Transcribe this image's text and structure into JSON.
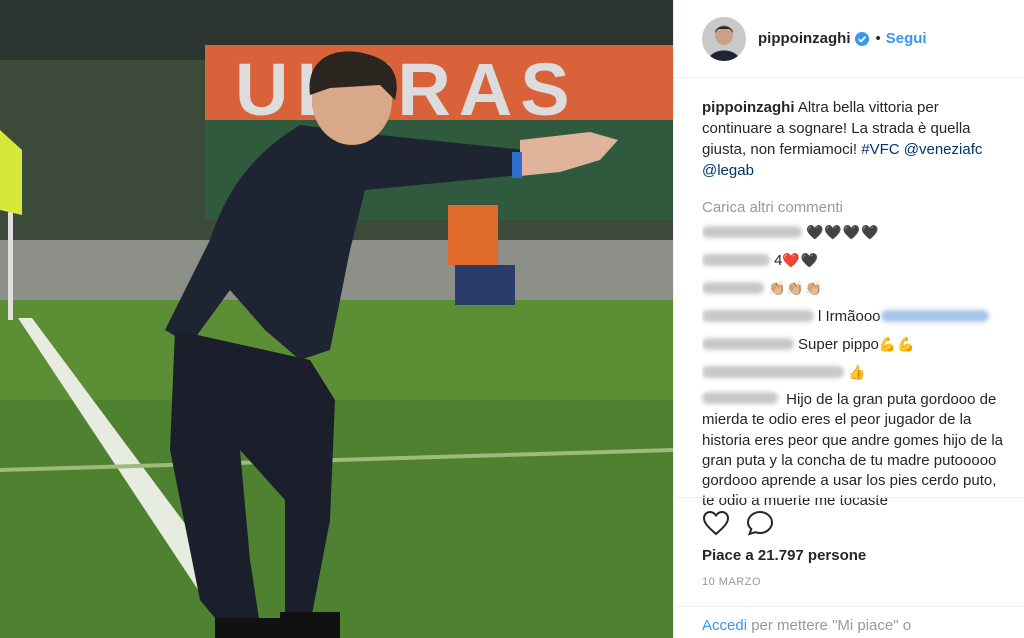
{
  "post": {
    "username": "pippoinzaghi",
    "verified": true,
    "separator": "•",
    "follow_label": "Segui"
  },
  "photo": {
    "banner_text": "ULTRAS"
  },
  "caption": {
    "username": "pippoinzaghi",
    "text": " Altra bella vittoria per continuare a sognare! La strada è quella giusta, non fermiamoci! ",
    "hashtag": "#VFC",
    "mention1": "@veneziafc",
    "mention2": "@legab"
  },
  "load_more_label": "Carica altri commenti",
  "comments": [
    {
      "text": "",
      "emoji": "🖤🖤🖤🖤"
    },
    {
      "text": "4 ",
      "emoji": "❤️🖤"
    },
    {
      "text": "",
      "emoji": "👏🏼👏🏼👏🏼"
    },
    {
      "text": "l Irmãooo ",
      "emoji": ""
    },
    {
      "text": " Super pippo",
      "emoji": "💪💪"
    },
    {
      "text": "",
      "emoji": "👍"
    }
  ],
  "long_comment": " Hijo de la gran puta gordooo de mierda te odio eres el peor jugador de la historia eres peor que andre gomes hijo de la gran puta y la concha de tu madre putooooo gordooo aprende a usar los pies cerdo puto, te odio a muerte me tocaste",
  "likes_text": "Piace a 21.797 persone",
  "date_text": "10 MARZO",
  "footer": {
    "login_link": "Accedi",
    "rest_text": " per mettere \"Mi piace\" o"
  },
  "icons": {
    "like": "heart-icon",
    "comment": "comment-icon",
    "verified": "verified-badge-icon"
  },
  "colors": {
    "link": "#3897f0",
    "tag": "#003569",
    "muted": "#999999"
  }
}
